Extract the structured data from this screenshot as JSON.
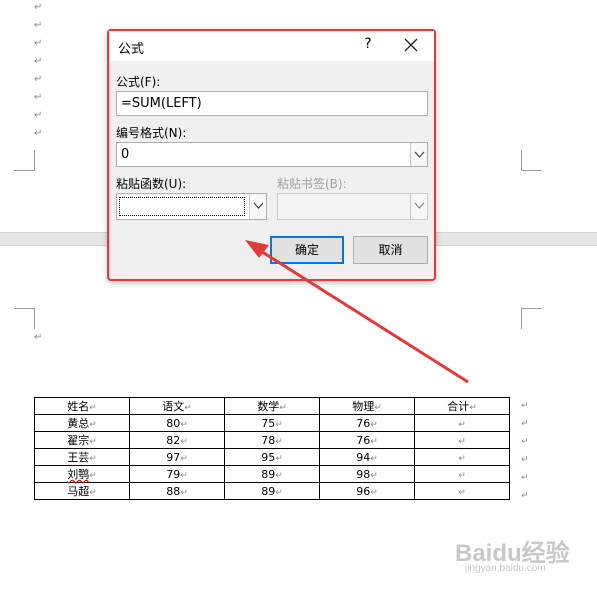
{
  "paragraph_mark": "↵",
  "dialog": {
    "title": "公式",
    "help_label": "?",
    "formula_label": "公式(F):",
    "formula_value": "=SUM(LEFT)",
    "number_format_label": "编号格式(N):",
    "number_format_value": "0",
    "paste_function_label": "粘贴函数(U):",
    "paste_function_value": "",
    "paste_bookmark_label": "粘贴书签(B):",
    "paste_bookmark_value": "",
    "ok_label": "确定",
    "cancel_label": "取消"
  },
  "table": {
    "headers": [
      "姓名",
      "语文",
      "数学",
      "物理",
      "合计"
    ],
    "rows": [
      [
        "黄总",
        "80",
        "75",
        "76",
        ""
      ],
      [
        "翟宗",
        "82",
        "78",
        "76",
        ""
      ],
      [
        "王芸",
        "97",
        "95",
        "94",
        ""
      ],
      [
        "刘鹗",
        "79",
        "89",
        "98",
        ""
      ],
      [
        "马超",
        "88",
        "89",
        "96",
        ""
      ]
    ]
  },
  "watermark": {
    "logo": "Baidu经验",
    "url": "jingyan.baidu.com"
  },
  "colors": {
    "annotation_red": "#e03a3a",
    "default_button_border": "#0078d7"
  }
}
